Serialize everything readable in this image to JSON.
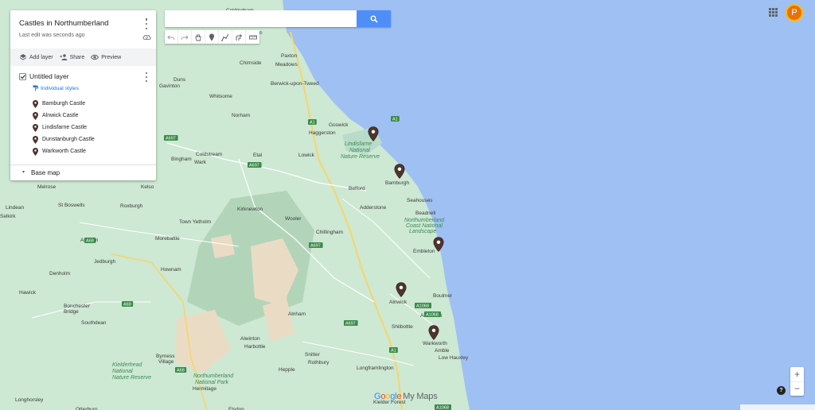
{
  "map": {
    "colors": {
      "sea": "#9fc0f2",
      "land": "#cde8d3",
      "park": "#eadcc4",
      "road": "#ffffff",
      "major_road": "#f6d56a"
    },
    "places": [
      {
        "name": "Coldingham",
        "style": "town"
      },
      {
        "name": "Reston",
        "style": "town"
      },
      {
        "name": "Chirnside",
        "style": "town"
      },
      {
        "name": "Paxton",
        "style": "town"
      },
      {
        "name": "Meadows",
        "style": "town"
      },
      {
        "name": "Duns",
        "style": "town"
      },
      {
        "name": "Gavinton",
        "style": "town"
      },
      {
        "name": "Berwick-upon-Tweed",
        "style": "town"
      },
      {
        "name": "Whitsome",
        "style": "town"
      },
      {
        "name": "Norham",
        "style": "town"
      },
      {
        "name": "Goswick",
        "style": "town"
      },
      {
        "name": "Haggerston",
        "style": "town"
      },
      {
        "name": "Lindisfarne",
        "style": "park"
      },
      {
        "name": "National",
        "style": "park"
      },
      {
        "name": "Nature Reserve",
        "style": "park"
      },
      {
        "name": "Bingham",
        "style": "town"
      },
      {
        "name": "Coldstream",
        "style": "town"
      },
      {
        "name": "Wark",
        "style": "town"
      },
      {
        "name": "Etal",
        "style": "town"
      },
      {
        "name": "Lowick",
        "style": "town"
      },
      {
        "name": "Belford",
        "style": "town"
      },
      {
        "name": "Bamburgh",
        "style": "town"
      },
      {
        "name": "Seahouses",
        "style": "town"
      },
      {
        "name": "Melrose",
        "style": "town"
      },
      {
        "name": "Kelso",
        "style": "town"
      },
      {
        "name": "Lindean",
        "style": "town"
      },
      {
        "name": "St Boswells",
        "style": "town"
      },
      {
        "name": "Roxburgh",
        "style": "town"
      },
      {
        "name": "Kirknewton",
        "style": "town"
      },
      {
        "name": "Adderstone",
        "style": "town"
      },
      {
        "name": "Beadnell",
        "style": "town"
      },
      {
        "name": "Selkirk",
        "style": "town"
      },
      {
        "name": "Town Yetholm",
        "style": "town"
      },
      {
        "name": "Wooler",
        "style": "town"
      },
      {
        "name": "Northumberland",
        "style": "park"
      },
      {
        "name": "Coast National",
        "style": "park"
      },
      {
        "name": "Landscape",
        "style": "park"
      },
      {
        "name": "Chillingham",
        "style": "town"
      },
      {
        "name": "Morebattle",
        "style": "town"
      },
      {
        "name": "Ancrum",
        "style": "town"
      },
      {
        "name": "Embleton",
        "style": "town"
      },
      {
        "name": "Jedburgh",
        "style": "town"
      },
      {
        "name": "Hownam",
        "style": "town"
      },
      {
        "name": "Denholm",
        "style": "town"
      },
      {
        "name": "Hawick",
        "style": "town"
      },
      {
        "name": "Bonchester",
        "style": "town"
      },
      {
        "name": "Bridge",
        "style": "town"
      },
      {
        "name": "Alnwick",
        "style": "town"
      },
      {
        "name": "Boulmer",
        "style": "town"
      },
      {
        "name": "Alnham",
        "style": "town"
      },
      {
        "name": "Alnmouth",
        "style": "town"
      },
      {
        "name": "Southdean",
        "style": "town"
      },
      {
        "name": "Shilbottle",
        "style": "town"
      },
      {
        "name": "Warkworth",
        "style": "town"
      },
      {
        "name": "Amble",
        "style": "town"
      },
      {
        "name": "Low Hauxley",
        "style": "town"
      },
      {
        "name": "Alwinton",
        "style": "town"
      },
      {
        "name": "Harbottle",
        "style": "town"
      },
      {
        "name": "Snitter",
        "style": "town"
      },
      {
        "name": "Byrness",
        "style": "town"
      },
      {
        "name": "Village",
        "style": "town"
      },
      {
        "name": "Kielderhead",
        "style": "park"
      },
      {
        "name": "National",
        "style": "park"
      },
      {
        "name": "Nature Reserve",
        "style": "park"
      },
      {
        "name": "Rothbury",
        "style": "town"
      },
      {
        "name": "Longframlington",
        "style": "town"
      },
      {
        "name": "Hepple",
        "style": "town"
      },
      {
        "name": "Northumberland",
        "style": "park"
      },
      {
        "name": "National Park",
        "style": "park"
      },
      {
        "name": "Hermitage",
        "style": "town"
      },
      {
        "name": "Longhorsley",
        "style": "town"
      },
      {
        "name": "Kielder Forest",
        "style": "town"
      },
      {
        "name": "Otterburn",
        "style": "town"
      },
      {
        "name": "Elsdon",
        "style": "town"
      }
    ],
    "road_labels": [
      "A1",
      "A697",
      "A698",
      "A1",
      "A697",
      "A697",
      "A68",
      "A697",
      "A68",
      "A68",
      "A1068",
      "A1",
      "A1068",
      "A1068"
    ],
    "markers": [
      {
        "name": "Lindisfarne Castle"
      },
      {
        "name": "Bamburgh Castle"
      },
      {
        "name": "Dunstanburgh Castle"
      },
      {
        "name": "Alnwick Castle"
      },
      {
        "name": "Warkworth Castle"
      }
    ]
  },
  "panel": {
    "title": "Castles in Northumberland",
    "last_edit": "Last edit was seconds ago",
    "actions": {
      "add_layer": "Add layer",
      "share": "Share",
      "preview": "Preview"
    },
    "layer": {
      "title": "Untitled layer",
      "styles": "Individual styles",
      "features": [
        "Bamburgh Castle",
        "Alnwick Castle",
        "Lindisfarne Castle",
        "Dunstanburgh Castle",
        "Warkworth Castle"
      ]
    },
    "base_map": "Base map"
  },
  "search": {
    "value": "",
    "placeholder": ""
  },
  "toolbar": {
    "tools": [
      "undo-icon",
      "redo-icon",
      "hand-icon",
      "marker-icon",
      "draw-line-icon",
      "route-icon",
      "ruler-icon"
    ]
  },
  "account": {
    "initial": "P"
  },
  "zoom": {
    "in": "+",
    "out": "−"
  },
  "help": "?",
  "brand": {
    "g1": "G",
    "g2": "o",
    "g3": "o",
    "g4": "g",
    "g5": "l",
    "g6": "e",
    "suffix": "My Maps"
  }
}
